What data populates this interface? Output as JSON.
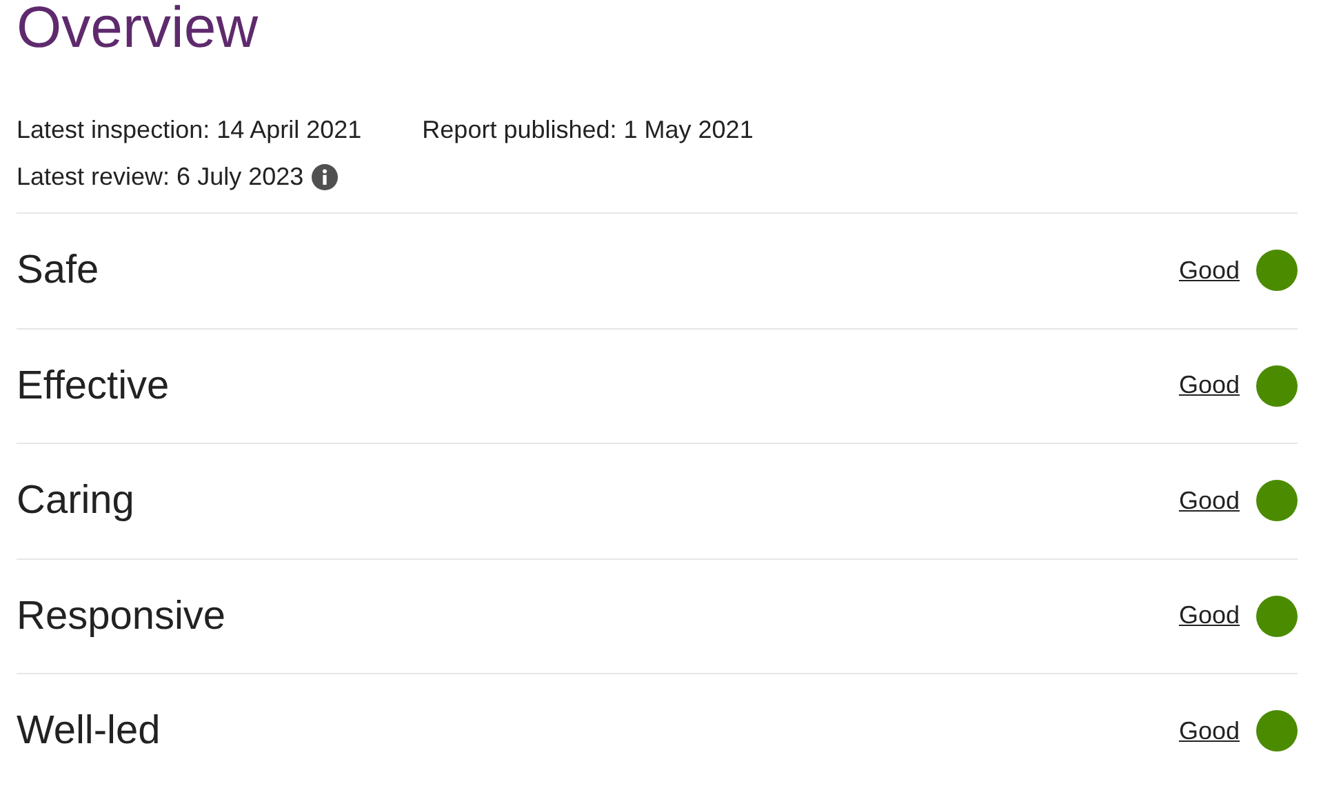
{
  "title": "Overview",
  "dates": [
    {
      "label": "Latest inspection: 14 April 2021"
    },
    {
      "label": "Report published: 1 May 2021"
    }
  ],
  "review": {
    "label": "Latest review: 6 July 2023"
  },
  "ratings": [
    {
      "area": "Safe",
      "rating": "Good",
      "color": "#4b8b00"
    },
    {
      "area": "Effective",
      "rating": "Good",
      "color": "#4b8b00"
    },
    {
      "area": "Caring",
      "rating": "Good",
      "color": "#4b8b00"
    },
    {
      "area": "Responsive",
      "rating": "Good",
      "color": "#4b8b00"
    },
    {
      "area": "Well-led",
      "rating": "Good",
      "color": "#4b8b00"
    }
  ]
}
